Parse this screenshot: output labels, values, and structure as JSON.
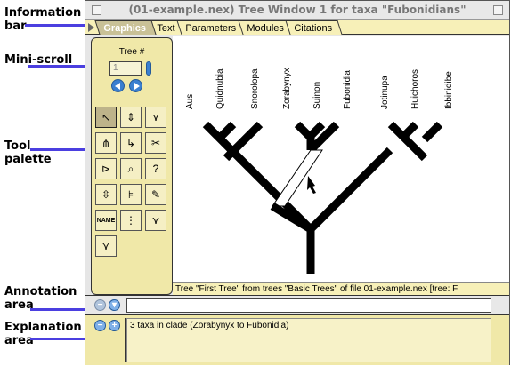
{
  "callouts": {
    "info_bar": "Information\nbar",
    "mini_scroll": "Mini-scroll",
    "tool_palette": "Tool\npalette",
    "annotation_area": "Annotation\narea",
    "explanation_area": "Explanation\narea"
  },
  "window": {
    "title": "(01-example.nex) Tree Window 1 for taxa \"Fubonidians\""
  },
  "tabs": [
    "Graphics",
    "Text",
    "Parameters",
    "Modules",
    "Citations"
  ],
  "active_tab": "Graphics",
  "palette": {
    "tree_label": "Tree #",
    "tree_number": "1"
  },
  "tools": [
    {
      "name": "arrow-tool-icon",
      "glyph": "↖"
    },
    {
      "name": "interchange-branches-tool-icon",
      "glyph": "⇕"
    },
    {
      "name": "collapse-branch-tool-icon",
      "glyph": "⋎"
    },
    {
      "name": "collapse-clade-tool-icon",
      "glyph": "⋔"
    },
    {
      "name": "reroot-tool-icon",
      "glyph": "↳"
    },
    {
      "name": "scissors-tool-icon",
      "glyph": "✂"
    },
    {
      "name": "ladderize-tool-icon",
      "glyph": "⊳"
    },
    {
      "name": "magnifier-tool-icon",
      "glyph": "⌕"
    },
    {
      "name": "help-tool-icon",
      "glyph": "?"
    },
    {
      "name": "branch-length-tool-icon",
      "glyph": "⇳"
    },
    {
      "name": "branch-info-tool-icon",
      "glyph": "⊧"
    },
    {
      "name": "paint-tool-icon",
      "glyph": "✎"
    },
    {
      "name": "name-tool-icon",
      "glyph": "NAME"
    },
    {
      "name": "select-clade-tool-icon",
      "glyph": "⋮"
    },
    {
      "name": "select-taxa-tool-icon",
      "glyph": "⋎"
    },
    {
      "name": "select-subtree-tool-icon",
      "glyph": "⋎"
    }
  ],
  "taxa": [
    "Aus",
    "Quidnubia",
    "Snorolopa",
    "Zorabynyx",
    "Suinon",
    "Fubonidia",
    "Jotinupa",
    "Huichoros",
    "Ibbinidibe"
  ],
  "status_line": "Tree \"First Tree\" from trees \"Basic Trees\" of file 01-example.nex   [tree: F",
  "explanation": "3 taxa in clade (Zorabynyx to Fubonidia)",
  "colors": {
    "callout_arrow": "#4b3fe0",
    "panel_yellow": "#f0e8a8",
    "tab_active": "#c9c197",
    "scroll_blue": "#3a7fd0"
  }
}
